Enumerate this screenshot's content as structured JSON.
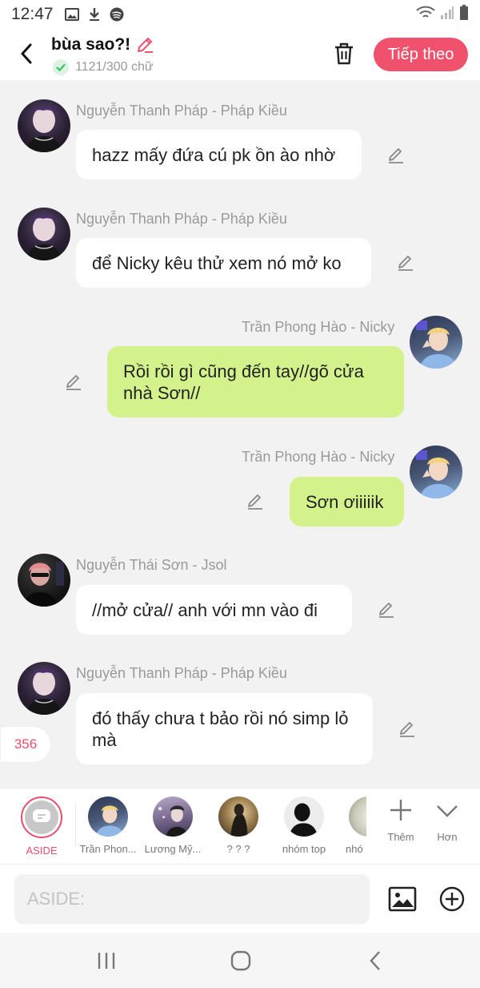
{
  "status": {
    "time": "12:47"
  },
  "header": {
    "title": "bùa sao?!",
    "word_count": "1121/300 chữ",
    "next_label": "Tiếp theo",
    "accent": "#f0526d"
  },
  "messages": [
    {
      "sender": "Nguyễn Thanh Pháp - Pháp Kiều",
      "text": "hazz mấy đứa cú pk ồn ào nhờ",
      "side": "left"
    },
    {
      "sender": "Nguyễn Thanh Pháp - Pháp Kiều",
      "text": "để Nicky kêu thử xem nó mở ko",
      "side": "left"
    },
    {
      "sender": "Trần Phong Hào - Nicky",
      "text": "Rồi rồi gì cũng đến tay//gõ cửa nhà Sơn//",
      "side": "right"
    },
    {
      "sender": "Trần Phong Hào - Nicky",
      "text": "Sơn ơiiiiik",
      "side": "right"
    },
    {
      "sender": "Nguyễn Thái Sơn - Jsol",
      "text": "//mở cửa// anh với mn vào đi",
      "side": "left"
    },
    {
      "sender": "Nguyễn Thanh Pháp - Pháp Kiều",
      "text": "đó thấy chưa t bảo rồi nó simp lỏ mà",
      "side": "left"
    }
  ],
  "counter": "356",
  "characters": [
    {
      "name": "ASIDE"
    },
    {
      "name": "Trần Phon..."
    },
    {
      "name": "Lương Mỹ..."
    },
    {
      "name": "? ? ?"
    },
    {
      "name": "nhóm top"
    },
    {
      "name": "nhó"
    }
  ],
  "tools": {
    "add_label": "Thêm",
    "more_label": "Hơn"
  },
  "input": {
    "placeholder": "ASIDE:"
  }
}
